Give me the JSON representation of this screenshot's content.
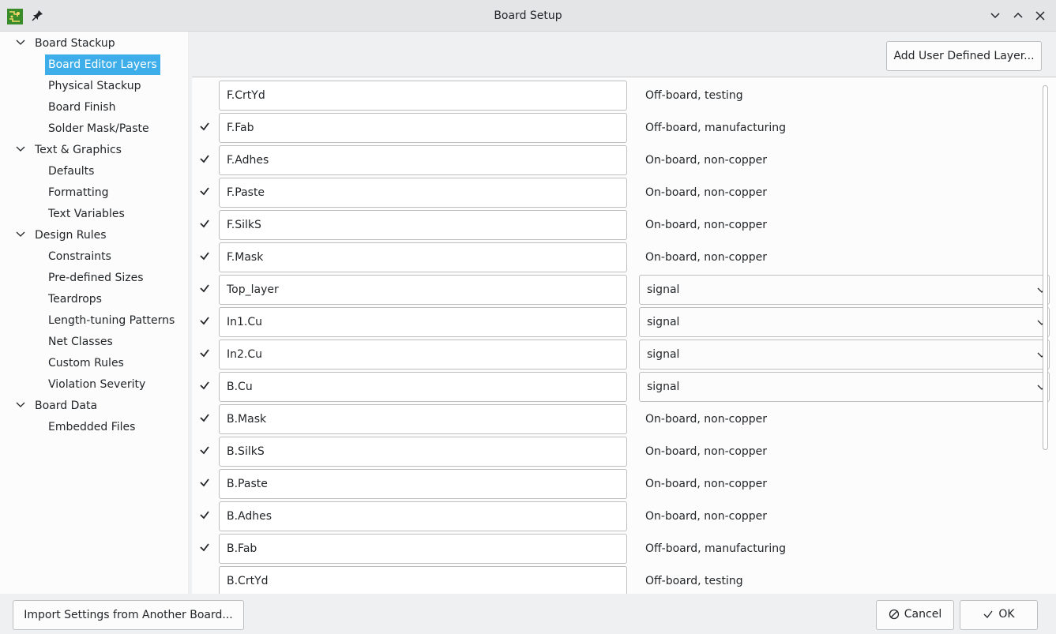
{
  "window": {
    "title": "Board Setup"
  },
  "sidebar": {
    "items": [
      {
        "label": "Board Stackup",
        "level": 0,
        "expanded": true
      },
      {
        "label": "Board Editor Layers",
        "level": 1,
        "selected": true
      },
      {
        "label": "Physical Stackup",
        "level": 1
      },
      {
        "label": "Board Finish",
        "level": 1
      },
      {
        "label": "Solder Mask/Paste",
        "level": 1
      },
      {
        "label": "Text & Graphics",
        "level": 0,
        "expanded": true
      },
      {
        "label": "Defaults",
        "level": 1
      },
      {
        "label": "Formatting",
        "level": 1
      },
      {
        "label": "Text Variables",
        "level": 1
      },
      {
        "label": "Design Rules",
        "level": 0,
        "expanded": true
      },
      {
        "label": "Constraints",
        "level": 1
      },
      {
        "label": "Pre-defined Sizes",
        "level": 1
      },
      {
        "label": "Teardrops",
        "level": 1
      },
      {
        "label": "Length-tuning Patterns",
        "level": 1
      },
      {
        "label": "Net Classes",
        "level": 1
      },
      {
        "label": "Custom Rules",
        "level": 1
      },
      {
        "label": "Violation Severity",
        "level": 1
      },
      {
        "label": "Board Data",
        "level": 0,
        "expanded": true
      },
      {
        "label": "Embedded Files",
        "level": 1
      }
    ]
  },
  "toolbar": {
    "add_layer_label": "Add User Defined Layer..."
  },
  "layers": [
    {
      "name": "F.CrtYd",
      "checked": false,
      "show_checkbox": false,
      "type": "Off-board, testing",
      "type_is_select": false
    },
    {
      "name": "F.Fab",
      "checked": true,
      "show_checkbox": true,
      "type": "Off-board, manufacturing",
      "type_is_select": false
    },
    {
      "name": "F.Adhes",
      "checked": true,
      "show_checkbox": true,
      "type": "On-board, non-copper",
      "type_is_select": false
    },
    {
      "name": "F.Paste",
      "checked": true,
      "show_checkbox": true,
      "type": "On-board, non-copper",
      "type_is_select": false
    },
    {
      "name": "F.SilkS",
      "checked": true,
      "show_checkbox": true,
      "type": "On-board, non-copper",
      "type_is_select": false
    },
    {
      "name": "F.Mask",
      "checked": true,
      "show_checkbox": true,
      "type": "On-board, non-copper",
      "type_is_select": false
    },
    {
      "name": "Top_layer",
      "checked": true,
      "show_checkbox": true,
      "type": "signal",
      "type_is_select": true
    },
    {
      "name": "In1.Cu",
      "checked": true,
      "show_checkbox": true,
      "type": "signal",
      "type_is_select": true
    },
    {
      "name": "In2.Cu",
      "checked": true,
      "show_checkbox": true,
      "type": "signal",
      "type_is_select": true
    },
    {
      "name": "B.Cu",
      "checked": true,
      "show_checkbox": true,
      "type": "signal",
      "type_is_select": true
    },
    {
      "name": "B.Mask",
      "checked": true,
      "show_checkbox": true,
      "type": "On-board, non-copper",
      "type_is_select": false
    },
    {
      "name": "B.SilkS",
      "checked": true,
      "show_checkbox": true,
      "type": "On-board, non-copper",
      "type_is_select": false
    },
    {
      "name": "B.Paste",
      "checked": true,
      "show_checkbox": true,
      "type": "On-board, non-copper",
      "type_is_select": false
    },
    {
      "name": "B.Adhes",
      "checked": true,
      "show_checkbox": true,
      "type": "On-board, non-copper",
      "type_is_select": false
    },
    {
      "name": "B.Fab",
      "checked": true,
      "show_checkbox": true,
      "type": "Off-board, manufacturing",
      "type_is_select": false
    },
    {
      "name": "B.CrtYd",
      "checked": false,
      "show_checkbox": false,
      "type": "Off-board, testing",
      "type_is_select": false
    }
  ],
  "footer": {
    "import_label": "Import Settings from Another Board...",
    "cancel_label": "Cancel",
    "ok_label": "OK"
  },
  "colors": {
    "selection": "#3daee9",
    "window_bg": "#eff0f1",
    "panel_bg": "#fcfcfc",
    "border": "#bcbebf"
  },
  "icons": {
    "app": "kicad-pcb-icon",
    "pin": "pin-icon",
    "minimize": "chevron-down-icon",
    "maximize": "chevron-up-icon",
    "close": "close-icon",
    "cancel": "cancel-circle-icon",
    "ok": "checkmark-icon"
  }
}
